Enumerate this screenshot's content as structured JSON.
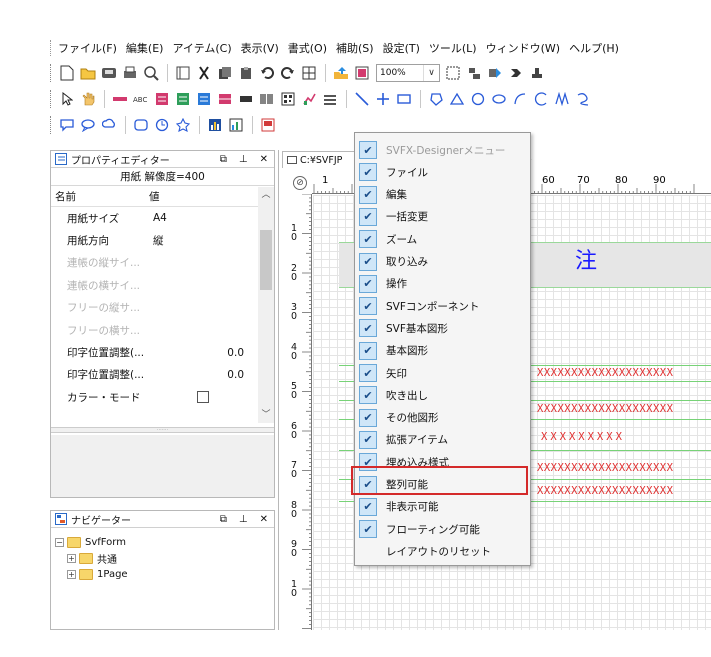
{
  "menubar": {
    "items": [
      "ファイル(F)",
      "編集(E)",
      "アイテム(C)",
      "表示(V)",
      "書式(O)",
      "補助(S)",
      "設定(T)",
      "ツール(L)",
      "ウィンドウ(W)",
      "ヘルプ(H)"
    ]
  },
  "toolbar1": {
    "zoom_value": "100%"
  },
  "property_panel": {
    "title": "プロパティエディター",
    "caption": "用紙 解像度=400",
    "header_name": "名前",
    "header_value": "値",
    "rows": [
      {
        "name": "用紙サイズ",
        "value": "A4",
        "disabled": false
      },
      {
        "name": "用紙方向",
        "value": "縦",
        "disabled": false
      },
      {
        "name": "連帳の縦サイ...",
        "value": "",
        "disabled": true
      },
      {
        "name": "連帳の横サイ...",
        "value": "",
        "disabled": true
      },
      {
        "name": "フリーの縦サ...",
        "value": "",
        "disabled": true
      },
      {
        "name": "フリーの横サ...",
        "value": "",
        "disabled": true
      },
      {
        "name": "印字位置調整(...",
        "value": "0.0",
        "disabled": false
      },
      {
        "name": "印字位置調整(...",
        "value": "0.0",
        "disabled": false
      },
      {
        "name": "カラー・モード",
        "value": "",
        "checkbox": true,
        "disabled": false
      }
    ]
  },
  "navigator_panel": {
    "title": "ナビゲーター",
    "tree": [
      {
        "label": "SvfForm",
        "expander": "⊟"
      },
      {
        "label": "共通",
        "expander": "⊞"
      },
      {
        "label": "1Page",
        "expander": "⊞"
      }
    ]
  },
  "document": {
    "tab_label": "C:¥SVFJP",
    "tab_suffix": "\\",
    "ruler_top": [
      "1",
      "60",
      "70",
      "80",
      "90"
    ],
    "ruler_left": [
      "1\n0",
      "2\n0",
      "3\n0",
      "4\n0",
      "5\n0",
      "6\n0",
      "7\n0",
      "8\n0",
      "9\n0",
      "1\n0"
    ],
    "title_char": "注",
    "x_lines": [
      "XXXXXXXXXXXXXXXXXXXX",
      "XXXXXXXXXXXXXXXXXXXX",
      "XXXXXXXXX",
      "XXXXXXXXXXXXXXXXXXXX",
      "XXXXXXXXXXXXXXXXXXXX"
    ]
  },
  "popup_menu": {
    "items": [
      {
        "label": "SVFX-Designerメニュー",
        "checked": true,
        "muted": true
      },
      {
        "label": "ファイル",
        "checked": true
      },
      {
        "label": "編集",
        "checked": true
      },
      {
        "label": "一括変更",
        "checked": true
      },
      {
        "label": "ズーム",
        "checked": true
      },
      {
        "label": "取り込み",
        "checked": true
      },
      {
        "label": "操作",
        "checked": true
      },
      {
        "label": "SVFコンポーネント",
        "checked": true
      },
      {
        "label": "SVF基本図形",
        "checked": true
      },
      {
        "label": "基本図形",
        "checked": true
      },
      {
        "label": "矢印",
        "checked": true
      },
      {
        "label": "吹き出し",
        "checked": true
      },
      {
        "label": "その他図形",
        "checked": true
      },
      {
        "label": "拡張アイテム",
        "checked": true
      },
      {
        "label": "埋め込み様式",
        "checked": true
      },
      {
        "label": "整列可能",
        "checked": true,
        "highlighted": true
      },
      {
        "label": "非表示可能",
        "checked": true
      },
      {
        "label": "フローティング可能",
        "checked": true
      },
      {
        "label": "レイアウトのリセット",
        "checked": false
      }
    ]
  },
  "colors": {
    "highlight": "#d42a2a",
    "title_char": "#1a1aff",
    "x_text": "#e03030",
    "check_bg": "#cfe6f8"
  }
}
